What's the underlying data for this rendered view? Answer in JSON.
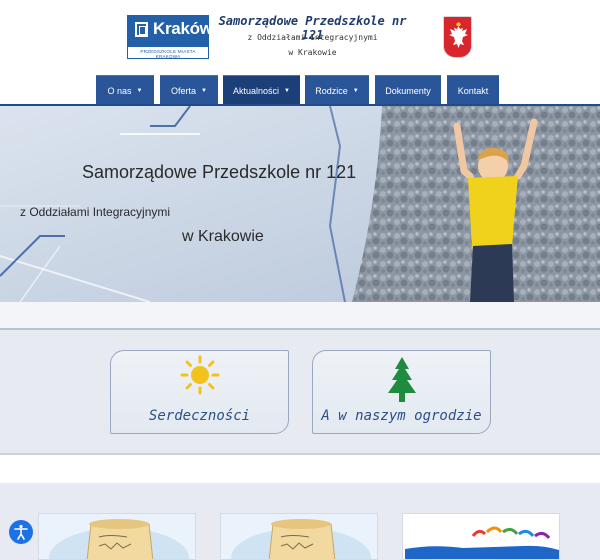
{
  "header": {
    "logo_title": "Kraków",
    "logo_subtitle": "PRZEDSZKOLE MIASTA KRAKOWA",
    "title": "Samorządowe Przedszkole nr 121",
    "subtitle_line1": "z Oddziałami Integracyjnymi",
    "subtitle_line2": "w Krakowie"
  },
  "nav": {
    "items": [
      {
        "label": "O nas",
        "caret": "▼"
      },
      {
        "label": "Oferta",
        "caret": "▼"
      },
      {
        "label": "Aktualności",
        "caret": "▼"
      },
      {
        "label": "Rodzice",
        "caret": "▼"
      },
      {
        "label": "Dokumenty",
        "caret": ""
      },
      {
        "label": "Kontakt",
        "caret": ""
      }
    ],
    "active_index": 2
  },
  "hero": {
    "line1": "Samorządowe Przedszkole nr 121",
    "line2": "z Oddziałami Integracyjnymi",
    "line3": "w Krakowie"
  },
  "features": [
    {
      "label": "Serdeczności",
      "icon": "sun-icon"
    },
    {
      "label": "A w naszym ogrodzie",
      "icon": "tree-icon"
    }
  ],
  "news": [
    {
      "image": "announcement-scroll-image"
    },
    {
      "image": "announcement-scroll-image"
    },
    {
      "image": "colorful-logo-image"
    }
  ],
  "colors": {
    "nav": "#2b5599",
    "nav_active": "#1c3f79",
    "accent_text": "#2b4f88",
    "accessibility": "#1d71e6"
  }
}
